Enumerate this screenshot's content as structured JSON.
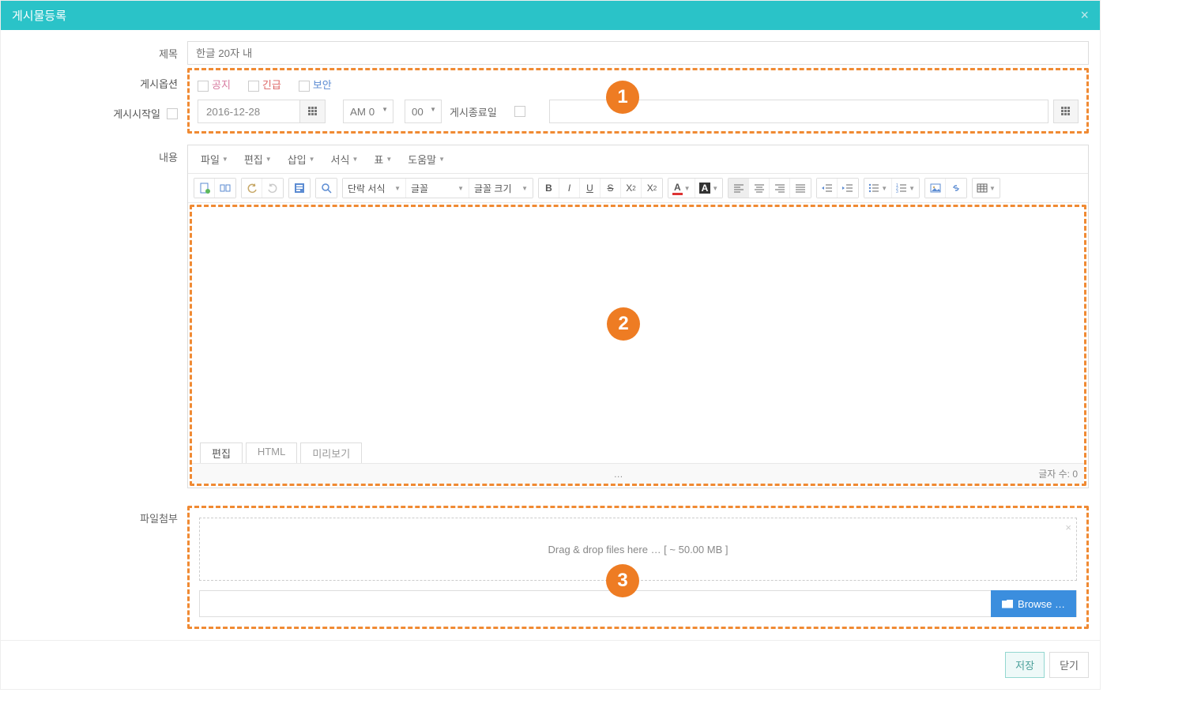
{
  "header": {
    "title": "게시물등록",
    "close_icon": "×"
  },
  "labels": {
    "title": "제목",
    "options": "게시옵션",
    "start_date": "게시시작일",
    "content": "내용",
    "attach": "파일첨부"
  },
  "title_field": {
    "placeholder": "한글 20자 내"
  },
  "options": {
    "notice": "공지",
    "urgent": "긴급",
    "secure": "보안"
  },
  "start_date": {
    "value": "2016-12-28",
    "ampm": "AM 0",
    "minute": "00"
  },
  "end_date": {
    "label": "게시종료일"
  },
  "editor": {
    "menu": {
      "file": "파일",
      "edit": "편집",
      "insert": "삽입",
      "format": "서식",
      "table": "표",
      "help": "도움말"
    },
    "toolbar": {
      "para_style": "단락 서식",
      "font": "글꼴",
      "font_size": "글꼴 크기"
    },
    "tabs": {
      "edit": "편집",
      "html": "HTML",
      "preview": "미리보기"
    },
    "footer": {
      "ellipsis": "…",
      "word_count": "글자 수: 0"
    }
  },
  "file": {
    "drop_text": "Drag & drop files here … [ ~ 50.00 MB ]",
    "browse": "Browse …"
  },
  "footer_buttons": {
    "save": "저장",
    "close": "닫기"
  },
  "annotations": {
    "a1": "1",
    "a2": "2",
    "a3": "3"
  }
}
